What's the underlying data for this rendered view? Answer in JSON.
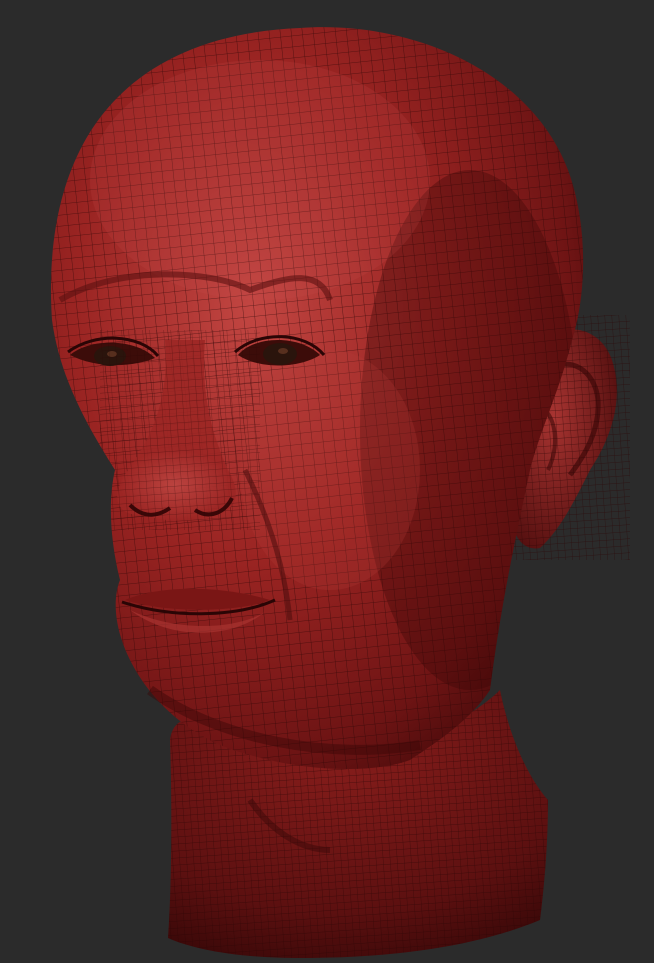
{
  "scene": {
    "subject": "sculpted-head-wireframe",
    "colors": {
      "background": "#2b2b2b",
      "skin_light": "#b8403d",
      "skin_base": "#8f1f1e",
      "skin_dark": "#4a0c0c",
      "wire": "#2a0505",
      "eye": "#2a140c"
    }
  }
}
